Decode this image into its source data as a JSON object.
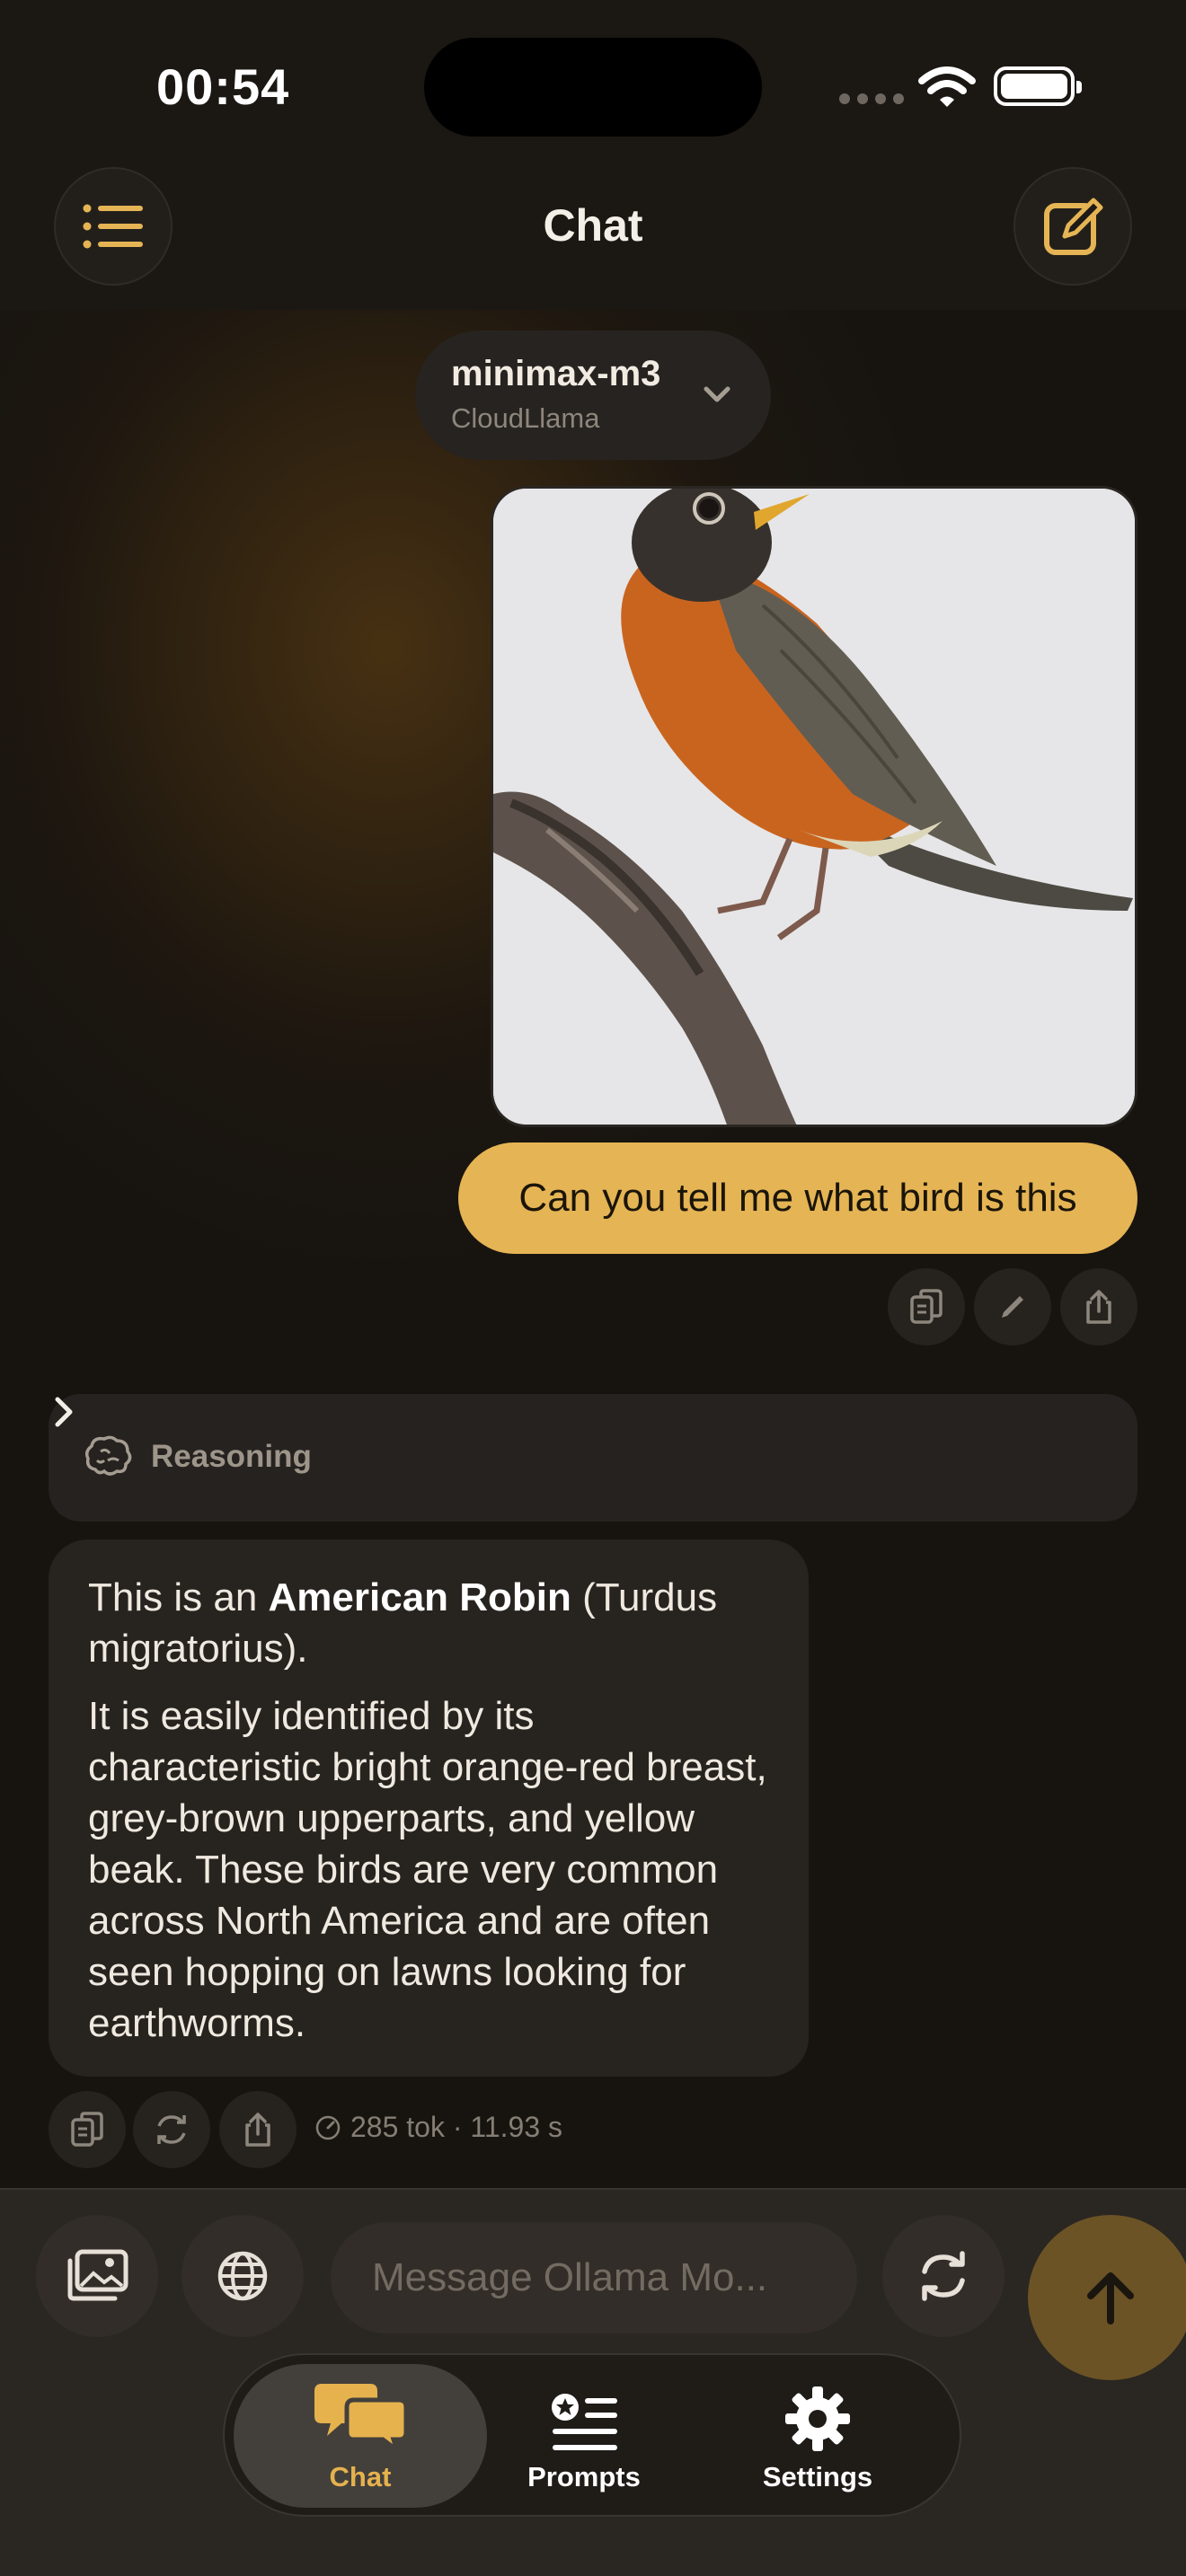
{
  "status_bar": {
    "time": "00:54"
  },
  "nav": {
    "title": "Chat"
  },
  "model": {
    "name": "minimax-m3",
    "provider": "CloudLlama"
  },
  "user_message": {
    "text": "Can you tell me what bird is this"
  },
  "reasoning": {
    "label": "Reasoning"
  },
  "assistant_message": {
    "p1_before": "This is an ",
    "p1_bold": "American Robin",
    "p1_after": " (Turdus migratorius).",
    "p2": "It is easily identified by its characteristic bright orange-red breast, grey-brown upperparts, and yellow beak. These birds are very common across North America and are often seen hopping on lawns looking for earthworms."
  },
  "stats": {
    "text": "285 tok · 11.93 s"
  },
  "composer": {
    "placeholder": "Message Ollama Mo..."
  },
  "tabs": [
    {
      "label": "Chat",
      "icon": "chat-bubbles-icon",
      "active": true
    },
    {
      "label": "Prompts",
      "icon": "prompts-list-icon",
      "active": false
    },
    {
      "label": "Settings",
      "icon": "gear-icon",
      "active": false
    }
  ],
  "colors": {
    "accent": "#e5b454",
    "background": "#171410",
    "send_button": "#6b5326"
  }
}
